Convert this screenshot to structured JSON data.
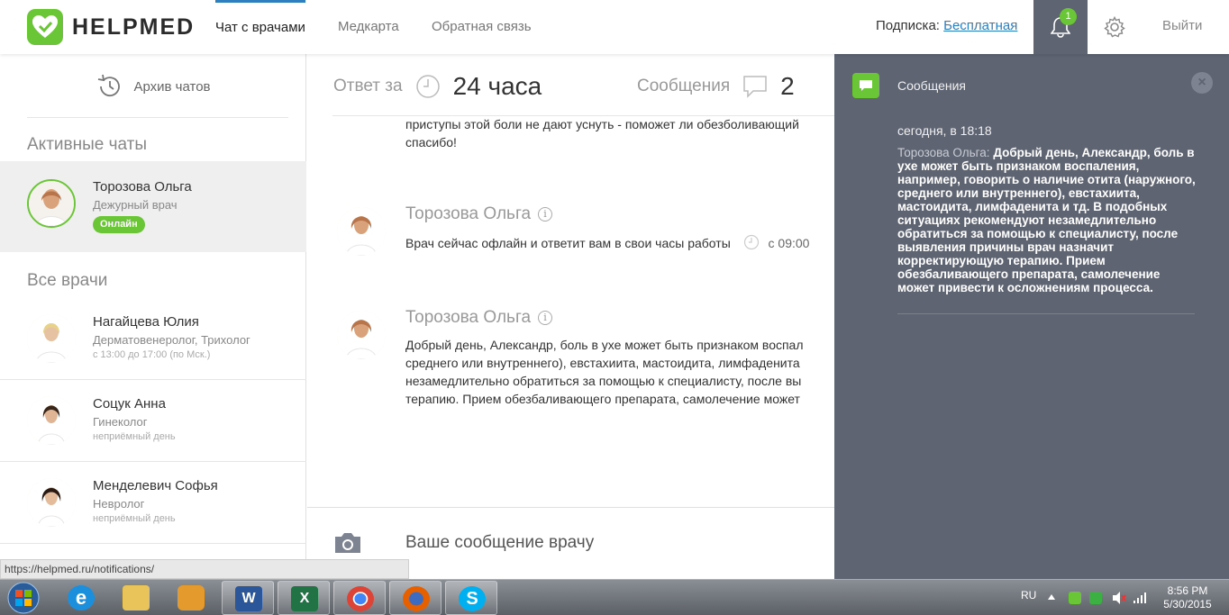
{
  "header": {
    "logo_text": "HELPMED",
    "nav": [
      "Чат с врачами",
      "Медкарта",
      "Обратная связь"
    ],
    "subscription_label": "Подписка:",
    "subscription_value": "Бесплатная",
    "notification_count": "1",
    "logout_label": "Выйти"
  },
  "sidebar": {
    "archive_label": "Архив чатов",
    "active_title": "Активные чаты",
    "active_chat": {
      "name": "Торозова Ольга",
      "role": "Дежурный врач",
      "status": "Онлайн"
    },
    "all_title": "Все врачи",
    "doctors": [
      {
        "name": "Нагайцева Юлия",
        "spec": "Дерматовенеролог, Трихолог",
        "hours": "с 13:00 до 17:00 (по Мск.)"
      },
      {
        "name": "Соцук Анна",
        "spec": "Гинеколог",
        "hours": "неприёмный день"
      },
      {
        "name": "Менделевич Софья",
        "spec": "Невролог",
        "hours": "неприёмный день"
      }
    ]
  },
  "main": {
    "reply_label": "Ответ за",
    "reply_value": "24 часа",
    "messages_label": "Сообщения",
    "messages_value": "2",
    "top_message_line1": "приступы этой боли не дают уснуть - поможет ли обезболивающий",
    "top_message_line2": "спасибо!",
    "message1": {
      "author": "Торозова Ольга",
      "text": "Врач сейчас офлайн и ответит вам в свои часы работы",
      "time": "с 09:00"
    },
    "message2": {
      "author": "Торозова Ольга",
      "lines": [
        "Добрый день, Александр, боль в ухе может быть признаком воспал",
        "среднего или внутреннего), евстахиита, мастоидита, лимфаденита",
        "незамедлительно обратиться за помощью к специалисту, после вы",
        "терапию. Прием обезбаливающего препарата, самолечение может"
      ]
    },
    "composer_placeholder": "Ваше сообщение врачу"
  },
  "panel": {
    "title": "Сообщения",
    "time": "сегодня, в 18:18",
    "author": "Торозова Ольга:",
    "text": "Добрый день, Александр, боль в ухе может быть признаком воспаления, например, говорить о наличие отита (наружного, среднего или внутреннего), евстахиита, мастоидита, лимфаденита и тд. В подобных ситуациях рекомендуют незамедлительно обратиться за помощью к специалисту, после выявления причины врач назначит корректирующую терапию. Прием обезбаливающего препарата, самолечение может привести к осложнениям процесса."
  },
  "status_url": "https://helpmed.ru/notifications/",
  "taskbar": {
    "language": "RU",
    "time": "8:56 PM",
    "date": "5/30/2015",
    "apps": [
      "start-icon",
      "ie-icon",
      "explorer-icon",
      "media-player-icon",
      "word-icon",
      "excel-icon",
      "chrome-icon",
      "firefox-icon",
      "skype-icon"
    ]
  },
  "colors": {
    "brand_green": "#6ac637",
    "panel_bg": "#5e6472",
    "link_blue": "#2f7fbf"
  }
}
